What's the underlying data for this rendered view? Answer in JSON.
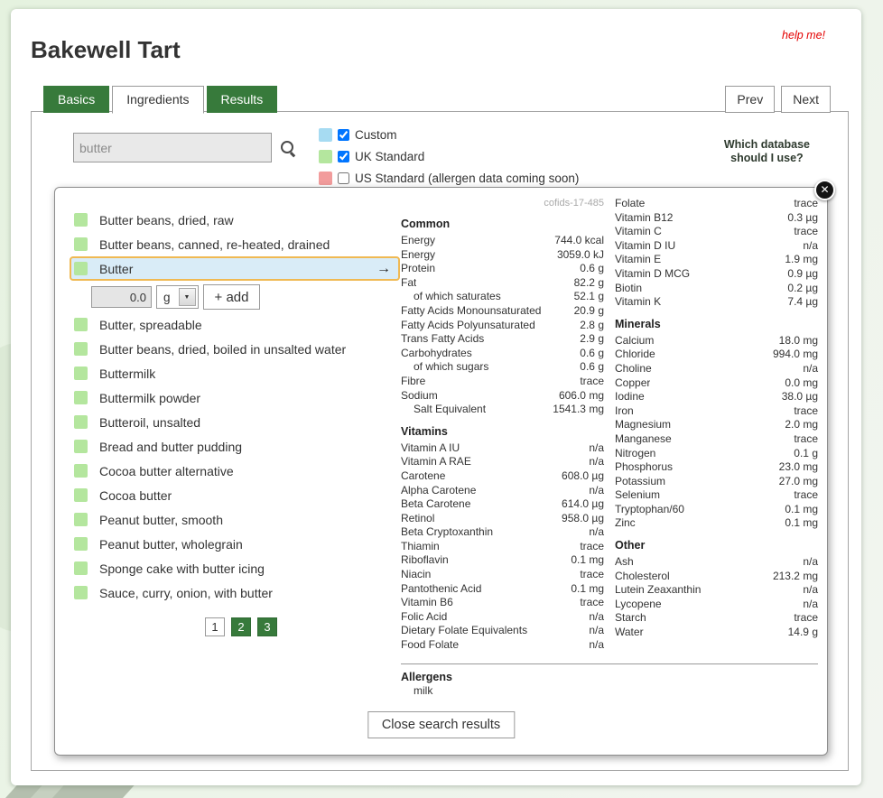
{
  "page": {
    "title": "Bakewell Tart",
    "help_link": "help me!"
  },
  "icons": {
    "close": "✕",
    "arrow_right": "→",
    "dropdown": "▼",
    "search": "css-magnifier"
  },
  "colors": {
    "accent_green": "#377a3b",
    "selected_border": "#f0b952",
    "selected_bg": "#d9ecf7"
  },
  "tabs": [
    {
      "label": "Basics",
      "active": false
    },
    {
      "label": "Ingredients",
      "active": true
    },
    {
      "label": "Results",
      "active": false
    }
  ],
  "nav": {
    "prev": "Prev",
    "next": "Next"
  },
  "search": {
    "value": "butter",
    "db_help": "Which database\nshould I use?",
    "databases": [
      {
        "label": "Custom",
        "checked": true,
        "swatch": "#a6dbf2"
      },
      {
        "label": "UK Standard",
        "checked": true,
        "swatch": "#b4e69e"
      },
      {
        "label": "US Standard (allergen data coming soon)",
        "checked": false,
        "swatch": "#f29c9c"
      }
    ]
  },
  "results": {
    "swatch_color": "#b4e69e",
    "items": [
      {
        "label": "Butter beans, dried, raw",
        "selected": false
      },
      {
        "label": "Butter beans, canned, re-heated, drained",
        "selected": false
      },
      {
        "label": "Butter",
        "selected": true
      },
      {
        "label": "Butter, spreadable",
        "selected": false
      },
      {
        "label": "Butter beans, dried, boiled in unsalted water",
        "selected": false
      },
      {
        "label": "Buttermilk",
        "selected": false
      },
      {
        "label": "Buttermilk powder",
        "selected": false
      },
      {
        "label": "Butteroil, unsalted",
        "selected": false
      },
      {
        "label": "Bread and butter pudding",
        "selected": false
      },
      {
        "label": "Cocoa butter alternative",
        "selected": false
      },
      {
        "label": "Cocoa butter",
        "selected": false
      },
      {
        "label": "Peanut butter, smooth",
        "selected": false
      },
      {
        "label": "Peanut butter, wholegrain",
        "selected": false
      },
      {
        "label": "Sponge cake with butter icing",
        "selected": false
      },
      {
        "label": "Sauce, curry, onion, with butter",
        "selected": false
      }
    ],
    "add_form": {
      "quantity": "0.0",
      "unit": "g",
      "add_label": "+ add"
    },
    "pagination": [
      {
        "label": "1",
        "current": true
      },
      {
        "label": "2",
        "current": false
      },
      {
        "label": "3",
        "current": false
      }
    ]
  },
  "nutrition": {
    "ref": "cofids-17-485",
    "close_label": "Close search results",
    "columns": [
      {
        "sections": [
          {
            "heading": "Common",
            "rows": [
              {
                "label": "Energy",
                "value": "744.0 kcal"
              },
              {
                "label": "Energy",
                "value": "3059.0 kJ"
              },
              {
                "label": "Protein",
                "value": "0.6 g"
              },
              {
                "label": "Fat",
                "value": "82.2 g"
              },
              {
                "label": "of which saturates",
                "value": "52.1 g",
                "indent": true
              },
              {
                "label": "Fatty Acids Monounsaturated",
                "value": "20.9 g"
              },
              {
                "label": "Fatty Acids Polyunsaturated",
                "value": "2.8 g"
              },
              {
                "label": "Trans Fatty Acids",
                "value": "2.9 g"
              },
              {
                "label": "Carbohydrates",
                "value": "0.6 g"
              },
              {
                "label": "of which sugars",
                "value": "0.6 g",
                "indent": true
              },
              {
                "label": "Fibre",
                "value": "trace"
              },
              {
                "label": "Sodium",
                "value": "606.0 mg"
              },
              {
                "label": "Salt Equivalent",
                "value": "1541.3 mg",
                "indent": true
              }
            ]
          },
          {
            "heading": "Vitamins",
            "rows": [
              {
                "label": "Vitamin A IU",
                "value": "n/a"
              },
              {
                "label": "Vitamin A RAE",
                "value": "n/a"
              },
              {
                "label": "Carotene",
                "value": "608.0 µg"
              },
              {
                "label": "Alpha Carotene",
                "value": "n/a"
              },
              {
                "label": "Beta Carotene",
                "value": "614.0 µg"
              },
              {
                "label": "Retinol",
                "value": "958.0 µg"
              },
              {
                "label": "Beta Cryptoxanthin",
                "value": "n/a"
              },
              {
                "label": "Thiamin",
                "value": "trace"
              },
              {
                "label": "Riboflavin",
                "value": "0.1 mg"
              },
              {
                "label": "Niacin",
                "value": "trace"
              },
              {
                "label": "Pantothenic Acid",
                "value": "0.1 mg"
              },
              {
                "label": "Vitamin B6",
                "value": "trace"
              },
              {
                "label": "Folic Acid",
                "value": "n/a"
              },
              {
                "label": "Dietary Folate Equivalents",
                "value": "n/a"
              },
              {
                "label": "Food Folate",
                "value": "n/a"
              }
            ]
          }
        ]
      },
      {
        "sections": [
          {
            "heading": "",
            "rows": [
              {
                "label": "Folate",
                "value": "trace"
              },
              {
                "label": "Vitamin B12",
                "value": "0.3 µg"
              },
              {
                "label": "Vitamin C",
                "value": "trace"
              },
              {
                "label": "Vitamin D IU",
                "value": "n/a"
              },
              {
                "label": "Vitamin E",
                "value": "1.9 mg"
              },
              {
                "label": "Vitamin D MCG",
                "value": "0.9 µg"
              },
              {
                "label": "Biotin",
                "value": "0.2 µg"
              },
              {
                "label": "Vitamin K",
                "value": "7.4 µg"
              }
            ]
          },
          {
            "heading": "Minerals",
            "rows": [
              {
                "label": "Calcium",
                "value": "18.0 mg"
              },
              {
                "label": "Chloride",
                "value": "994.0 mg"
              },
              {
                "label": "Choline",
                "value": "n/a"
              },
              {
                "label": "Copper",
                "value": "0.0 mg"
              },
              {
                "label": "Iodine",
                "value": "38.0 µg"
              },
              {
                "label": "Iron",
                "value": "trace"
              },
              {
                "label": "Magnesium",
                "value": "2.0 mg"
              },
              {
                "label": "Manganese",
                "value": "trace"
              },
              {
                "label": "Nitrogen",
                "value": "0.1 g"
              },
              {
                "label": "Phosphorus",
                "value": "23.0 mg"
              },
              {
                "label": "Potassium",
                "value": "27.0 mg"
              },
              {
                "label": "Selenium",
                "value": "trace"
              },
              {
                "label": "Tryptophan/60",
                "value": "0.1 mg"
              },
              {
                "label": "Zinc",
                "value": "0.1 mg"
              }
            ]
          },
          {
            "heading": "Other",
            "rows": [
              {
                "label": "Ash",
                "value": "n/a"
              },
              {
                "label": "Cholesterol",
                "value": "213.2 mg"
              },
              {
                "label": "Lutein Zeaxanthin",
                "value": "n/a"
              },
              {
                "label": "Lycopene",
                "value": "n/a"
              },
              {
                "label": "Starch",
                "value": "trace"
              },
              {
                "label": "Water",
                "value": "14.9 g"
              }
            ]
          }
        ]
      }
    ],
    "allergens": {
      "heading": "Allergens",
      "items": [
        "milk"
      ]
    }
  }
}
